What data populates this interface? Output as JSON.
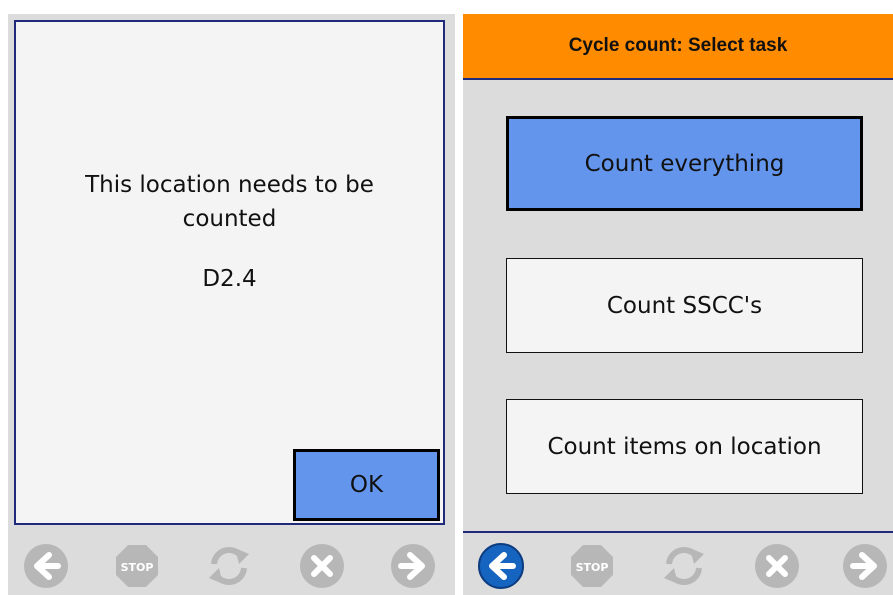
{
  "left_screen": {
    "message": "This location needs to be counted",
    "location": "D2.4",
    "ok_label": "OK",
    "nav": {
      "back_icon": "arrow-left-icon",
      "stop_icon": "stop-icon",
      "stop_label": "STOP",
      "refresh_icon": "refresh-icon",
      "cancel_icon": "cancel-icon",
      "forward_icon": "arrow-right-icon"
    }
  },
  "right_screen": {
    "title": "Cycle count: Select task",
    "tasks": [
      {
        "label": "Count everything",
        "selected": true
      },
      {
        "label": "Count SSCC's",
        "selected": false
      },
      {
        "label": "Count items on location",
        "selected": false
      }
    ],
    "nav": {
      "back_icon": "arrow-left-icon",
      "back_active": true,
      "stop_icon": "stop-icon",
      "stop_label": "STOP",
      "refresh_icon": "refresh-icon",
      "cancel_icon": "cancel-icon",
      "forward_icon": "arrow-right-icon"
    }
  },
  "colors": {
    "header": "#ff8c00",
    "selected_button": "#6495ed",
    "border": "#1f2a7a",
    "nav_disabled": "#b7b7b7",
    "nav_active": "#1565c0"
  }
}
